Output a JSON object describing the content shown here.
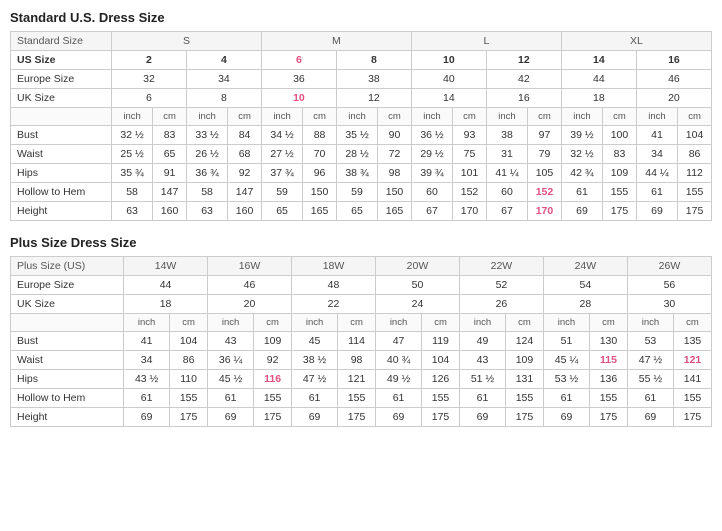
{
  "standard": {
    "title": "Standard U.S. Dress Size",
    "size_groups": [
      "S",
      "M",
      "L",
      "XL"
    ],
    "header_row": [
      "Standard Size",
      "S",
      "",
      "",
      "",
      "M",
      "",
      "",
      "",
      "L",
      "",
      "",
      "",
      "XL",
      "",
      "",
      ""
    ],
    "us_sizes": [
      "US Size",
      "2",
      "4",
      "6",
      "8",
      "10",
      "12",
      "14",
      "16"
    ],
    "europe_sizes": [
      "Europe Size",
      "32",
      "34",
      "36",
      "38",
      "40",
      "42",
      "44",
      "46"
    ],
    "uk_sizes": [
      "UK Size",
      "6",
      "8",
      "10",
      "12",
      "14",
      "16",
      "18",
      "20"
    ],
    "unit_row": [
      "",
      "inch",
      "cm",
      "inch",
      "cm",
      "inch",
      "cm",
      "inch",
      "cm",
      "inch",
      "cm",
      "inch",
      "cm",
      "inch",
      "cm",
      "inch",
      "cm"
    ],
    "bust": [
      "Bust",
      "32 ½",
      "83",
      "33 ½",
      "84",
      "34 ½",
      "88",
      "35 ½",
      "90",
      "36 ½",
      "93",
      "38",
      "97",
      "39 ½",
      "100",
      "41",
      "104"
    ],
    "waist": [
      "Waist",
      "25 ½",
      "65",
      "26 ½",
      "68",
      "27 ½",
      "70",
      "28 ½",
      "72",
      "29 ½",
      "75",
      "31",
      "79",
      "32 ½",
      "83",
      "34",
      "86"
    ],
    "hips": [
      "Hips",
      "35 ¾",
      "91",
      "36 ¾",
      "92",
      "37 ¾",
      "96",
      "38 ¾",
      "98",
      "39 ¾",
      "101",
      "41 ¼",
      "105",
      "42 ¾",
      "109",
      "44 ¼",
      "112"
    ],
    "hollow": [
      "Hollow to Hem",
      "58",
      "147",
      "58",
      "147",
      "59",
      "150",
      "59",
      "150",
      "60",
      "152",
      "60",
      "152",
      "61",
      "155",
      "61",
      "155"
    ],
    "height": [
      "Height",
      "63",
      "160",
      "63",
      "160",
      "65",
      "165",
      "65",
      "165",
      "67",
      "170",
      "67",
      "170",
      "69",
      "175",
      "69",
      "175"
    ]
  },
  "plus": {
    "title": "Plus Size Dress Size",
    "plus_sizes": [
      "Plus Size (US)",
      "14W",
      "16W",
      "18W",
      "20W",
      "22W",
      "24W",
      "26W"
    ],
    "europe_sizes": [
      "Europe Size",
      "44",
      "46",
      "48",
      "50",
      "52",
      "54",
      "56"
    ],
    "uk_sizes": [
      "UK Size",
      "18",
      "20",
      "22",
      "24",
      "26",
      "28",
      "30"
    ],
    "unit_row": [
      "",
      "inch",
      "cm",
      "inch",
      "cm",
      "inch",
      "cm",
      "inch",
      "cm",
      "inch",
      "cm",
      "inch",
      "cm",
      "inch",
      "cm"
    ],
    "bust": [
      "Bust",
      "41",
      "104",
      "43",
      "109",
      "45",
      "114",
      "47",
      "119",
      "49",
      "124",
      "51",
      "130",
      "53",
      "135"
    ],
    "waist": [
      "Waist",
      "34",
      "86",
      "36 ¼",
      "92",
      "38 ½",
      "98",
      "40 ¾",
      "104",
      "43",
      "109",
      "45 ¼",
      "115",
      "47 ½",
      "121"
    ],
    "hips": [
      "Hips",
      "43 ½",
      "110",
      "45 ½",
      "116",
      "47 ½",
      "121",
      "49 ½",
      "126",
      "51 ½",
      "131",
      "53 ½",
      "136",
      "55 ½",
      "141"
    ],
    "hollow": [
      "Hollow to Hem",
      "61",
      "155",
      "61",
      "155",
      "61",
      "155",
      "61",
      "155",
      "61",
      "155",
      "61",
      "155",
      "61",
      "155"
    ],
    "height": [
      "Height",
      "69",
      "175",
      "69",
      "175",
      "69",
      "175",
      "69",
      "175",
      "69",
      "175",
      "69",
      "175",
      "69",
      "175"
    ]
  }
}
